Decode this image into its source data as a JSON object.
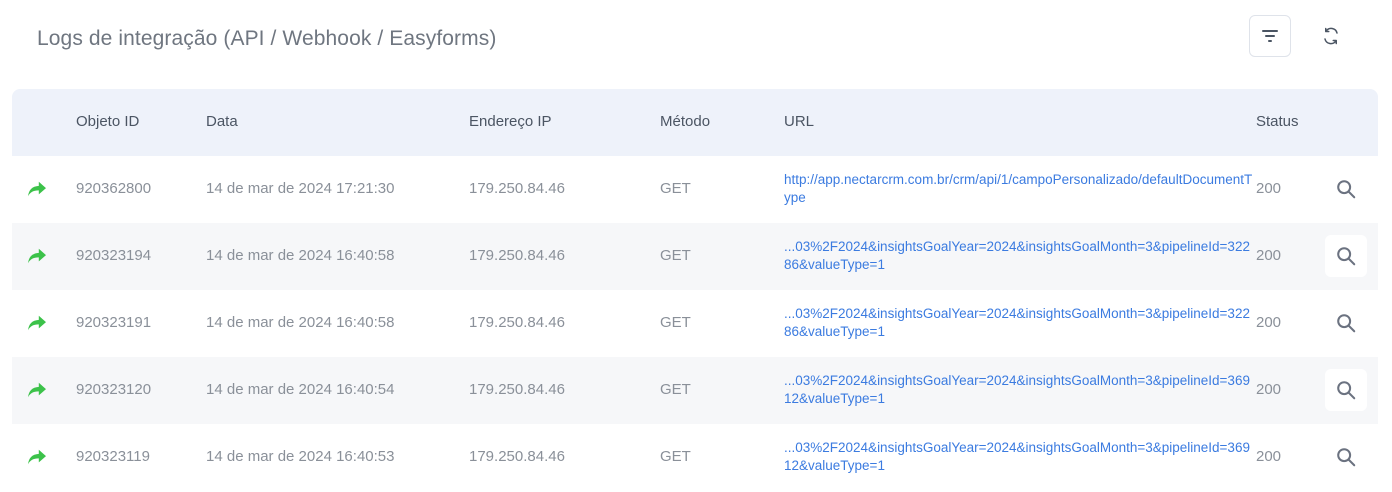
{
  "header": {
    "title": "Logs de integração (API / Webhook / Easyforms)",
    "filter_icon": "filter-lines-icon",
    "refresh_icon": "refresh-icon"
  },
  "table": {
    "columns": {
      "object_id": "Objeto ID",
      "date": "Data",
      "ip": "Endereço IP",
      "method": "Método",
      "url": "URL",
      "status": "Status"
    },
    "rows": [
      {
        "object_id": "920362800",
        "date": "14 de mar de 2024 17:21:30",
        "ip": "179.250.84.46",
        "method": "GET",
        "url": "http://app.nectarcrm.com.br/crm/api/1/campoPersonalizado/defaultDocumentType",
        "status": "200"
      },
      {
        "object_id": "920323194",
        "date": "14 de mar de 2024 16:40:58",
        "ip": "179.250.84.46",
        "method": "GET",
        "url": "...03%2F2024&insightsGoalYear=2024&insightsGoalMonth=3&pipelineId=32286&valueType=1",
        "status": "200"
      },
      {
        "object_id": "920323191",
        "date": "14 de mar de 2024 16:40:58",
        "ip": "179.250.84.46",
        "method": "GET",
        "url": "...03%2F2024&insightsGoalYear=2024&insightsGoalMonth=3&pipelineId=32286&valueType=1",
        "status": "200"
      },
      {
        "object_id": "920323120",
        "date": "14 de mar de 2024 16:40:54",
        "ip": "179.250.84.46",
        "method": "GET",
        "url": "...03%2F2024&insightsGoalYear=2024&insightsGoalMonth=3&pipelineId=36912&valueType=1",
        "status": "200"
      },
      {
        "object_id": "920323119",
        "date": "14 de mar de 2024 16:40:53",
        "ip": "179.250.84.46",
        "method": "GET",
        "url": "...03%2F2024&insightsGoalYear=2024&insightsGoalMonth=3&pipelineId=36912&valueType=1",
        "status": "200"
      }
    ]
  },
  "colors": {
    "accent_green": "#3cc24a",
    "link_blue": "#3b7be0",
    "header_bg": "#eef2fa",
    "alt_row_bg": "#f6f7f9"
  }
}
